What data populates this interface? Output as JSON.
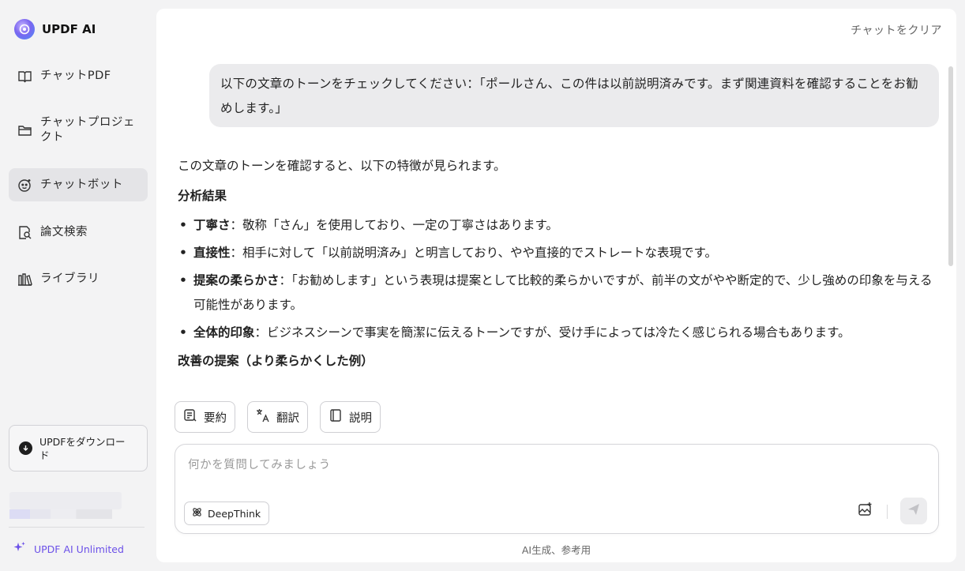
{
  "app": {
    "name": "UPDF AI"
  },
  "sidebar": {
    "items": [
      {
        "label": "チャットPDF",
        "icon": "book-chat-icon"
      },
      {
        "label": "チャットプロジェクト",
        "icon": "folder-icon"
      },
      {
        "label": "チャットボット",
        "icon": "bot-face-icon",
        "active": true
      },
      {
        "label": "論文検索",
        "icon": "document-search-icon"
      },
      {
        "label": "ライブラリ",
        "icon": "library-icon"
      }
    ],
    "download_label": "UPDFをダウンロード",
    "unlimited_label": "UPDF AI Unlimited"
  },
  "header": {
    "clear_label": "チャットをクリア"
  },
  "conversation": {
    "user_message": "以下の文章のトーンをチェックしてください：「ポールさん、この件は以前説明済みです。まず関連資料を確認することをお勧めします。」",
    "answer": {
      "intro": "この文章のトーンを確認すると、以下の特徴が見られます。",
      "heading": "分析結果",
      "bullets": [
        {
          "term": "丁寧さ",
          "text": "：敬称「さん」を使用しており、一定の丁寧さはあります。"
        },
        {
          "term": "直接性",
          "text": "：相手に対して「以前説明済み」と明言しており、やや直接的でストレートな表現です。"
        },
        {
          "term": "提案の柔らかさ",
          "text": "：「お勧めします」という表現は提案として比較的柔らかいですが、前半の文がやや断定的で、少し強めの印象を与える可能性があります。"
        },
        {
          "term": "全体的印象",
          "text": "：ビジネスシーンで事実を簡潔に伝えるトーンですが、受け手によっては冷たく感じられる場合もあります。"
        }
      ],
      "cut_heading": "改善の提案（より柔らかくした例）"
    }
  },
  "quick_actions": [
    {
      "label": "要約",
      "icon": "summary-icon"
    },
    {
      "label": "翻訳",
      "icon": "translate-icon"
    },
    {
      "label": "説明",
      "icon": "book-icon"
    }
  ],
  "composer": {
    "placeholder": "何かを質問してみましょう",
    "deepthink_label": "DeepThink"
  },
  "footer": {
    "note": "AI生成、参考用"
  },
  "colors": {
    "accent": "#6b50e8",
    "active_nav": "#e4e4e7",
    "bubble": "#ebebed"
  }
}
